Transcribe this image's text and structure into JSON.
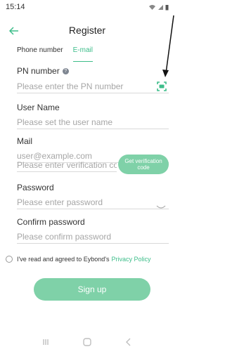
{
  "status": {
    "time": "15:14"
  },
  "header": {
    "title": "Register",
    "back_icon": "arrow-left-icon"
  },
  "tabs": [
    {
      "label": "Phone number",
      "active": false
    },
    {
      "label": "E-mail",
      "active": true
    }
  ],
  "form": {
    "pn": {
      "label": "PN number",
      "placeholder": "Please enter the PN number",
      "help_icon": "help-circle-icon",
      "scan_icon": "scan-icon"
    },
    "username": {
      "label": "User Name",
      "placeholder": "Please set the user name"
    },
    "mail": {
      "label": "Mail",
      "placeholder": "user@example.com"
    },
    "code": {
      "placeholder": "Please enter verification code",
      "button": "Get verification code"
    },
    "password": {
      "label": "Password",
      "placeholder": "Please enter password",
      "eye_icon": "eye-closed-icon"
    },
    "confirm": {
      "label": "Confirm password",
      "placeholder": "Please confirm password"
    }
  },
  "agreement": {
    "text": "I've read and agreed to Eybond's",
    "link": "Privacy Policy",
    "checked": false
  },
  "signup_button": "Sign up",
  "colors": {
    "accent": "#3dbd8a",
    "button": "#7fd1a8"
  }
}
